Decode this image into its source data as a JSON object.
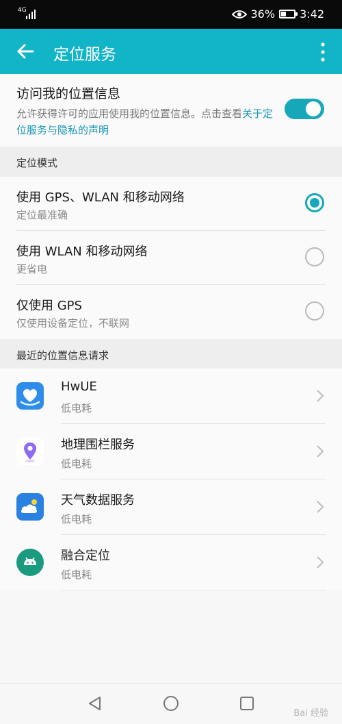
{
  "status_bar": {
    "network": "4G",
    "battery_percent": "36%",
    "time": "3:42",
    "eye_icon": "eye-icon"
  },
  "app_bar": {
    "title": "定位服务",
    "back_icon": "arrow-left-icon",
    "more_icon": "more-vertical-icon"
  },
  "access": {
    "title": "访问我的位置信息",
    "description": "允许获得许可的应用使用我的位置信息。点击查看",
    "link": "关于定位服务与隐私的声明",
    "enabled": true
  },
  "mode_section": {
    "header": "定位模式",
    "items": [
      {
        "title": "使用 GPS、WLAN 和移动网络",
        "subtitle": "定位最准确",
        "selected": true
      },
      {
        "title": "使用 WLAN 和移动网络",
        "subtitle": "更省电",
        "selected": false
      },
      {
        "title": "仅使用 GPS",
        "subtitle": "仅使用设备定位，不联网",
        "selected": false
      }
    ]
  },
  "requests_section": {
    "header": "最近的位置信息请求",
    "items": [
      {
        "name": "HwUE",
        "usage": "低电耗",
        "icon": "hwue-app-icon"
      },
      {
        "name": "地理围栏服务",
        "usage": "低电耗",
        "icon": "location-pin-app-icon"
      },
      {
        "name": "天气数据服务",
        "usage": "低电耗",
        "icon": "weather-app-icon"
      },
      {
        "name": "融合定位",
        "usage": "低电耗",
        "icon": "android-app-icon"
      }
    ]
  },
  "nav_bar": {
    "back": "back-triangle-icon",
    "home": "home-circle-icon",
    "recents": "recents-square-icon"
  },
  "watermark": "Bai 经验"
}
